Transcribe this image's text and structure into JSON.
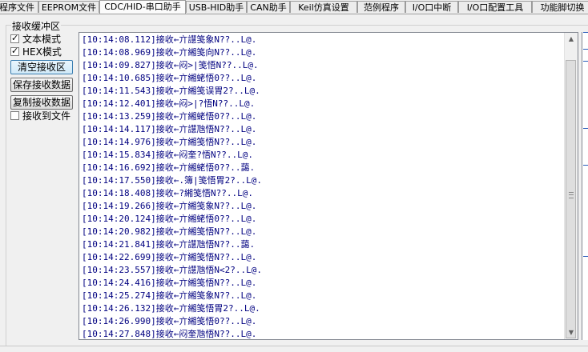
{
  "tabs": [
    {
      "label": "程序文件",
      "active": false
    },
    {
      "label": "EEPROM文件",
      "active": false
    },
    {
      "label": "CDC/HID-串口助手",
      "active": true
    },
    {
      "label": "USB-HID助手",
      "active": false
    },
    {
      "label": "CAN助手",
      "active": false
    },
    {
      "label": "Keil仿真设置",
      "active": false
    },
    {
      "label": "范例程序",
      "active": false
    },
    {
      "label": "I/O口中断",
      "active": false
    },
    {
      "label": "I/O口配置工具",
      "active": false
    },
    {
      "label": "功能脚切换",
      "active": false
    }
  ],
  "receive_buffer": {
    "group_title": "接收缓冲区",
    "text_mode": {
      "label": "文本模式",
      "checked": true
    },
    "hex_mode": {
      "label": "HEX模式",
      "checked": true
    },
    "clear_button": "清空接收区",
    "save_button": "保存接收数据",
    "copy_button": "复制接收数据",
    "receive_to_file": {
      "label": "接收到文件",
      "checked": false
    }
  },
  "log_lines": [
    "[10:14:08.112]接收←亣譿笺象N??..L@.",
    "[10:14:08.969]接收←亣緗笺向N??..L@.",
    "[10:14:09.827]接收←闷>|笺悟N??..L@.",
    "[10:14:10.685]接收←亣緗蛯悟0??..L@.",
    "[10:14:11.543]接收←亣緗笺误胃2?..L@.",
    "[10:14:12.401]接收←闷>|?悟N??..L@.",
    "[10:14:13.259]接收←亣緗蛯悟0??..L@.",
    "[10:14:14.117]接收←亣譿虺悟N??..L@.",
    "[10:14:14.976]接收←亣緗笺悟N??..L@.",
    "[10:14:15.834]接收←闷奎?悟N??..L@.",
    "[10:14:16.692]接收←亣緗蛯悟0??..藹.",
    "[10:14:17.550]接收←.簿|笺悟胃2?..L@.",
    "[10:14:18.408]接收←?緗笺悟N??..L@.",
    "[10:14:19.266]接收←亣緗笺象N??..L@.",
    "[10:14:20.124]接收←亣緗蛯悟0??..L@.",
    "[10:14:20.982]接收←亣緗笺悟N??..L@.",
    "[10:14:21.841]接收←亣譿虺悟N??..藹.",
    "[10:14:22.699]接收←亣緗笺悟N??..L@.",
    "[10:14:23.557]接收←亣譿虺悟N<2?..L@.",
    "[10:14:24.416]接收←亣緗笺悟N??..L@.",
    "[10:14:25.274]接收←亣緗笺象N??..L@.",
    "[10:14:26.132]接收←亣緗笺悟胃2?..L@.",
    "[10:14:26.990]接收←亣緗笺悟0??..L@.",
    "[10:14:27.848]接收←闷奎虺悟N??..L@."
  ]
}
